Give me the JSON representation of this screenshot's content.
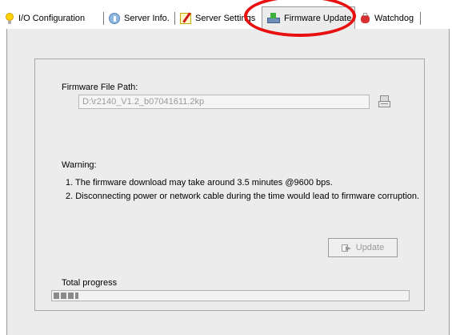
{
  "tabs": [
    {
      "label": "I/O Configuration",
      "icon": "bulb-icon"
    },
    {
      "label": "Server Info.",
      "icon": "info-icon"
    },
    {
      "label": "Server Settings",
      "icon": "settings-icon"
    },
    {
      "label": "Firmware Update",
      "icon": "firmware-icon",
      "active": true
    },
    {
      "label": "Watchdog",
      "icon": "watchdog-icon"
    }
  ],
  "firmware": {
    "path_label": "Firmware File Path:",
    "path_value": "D:\\r2140_V1.2_b07041611.2kp",
    "warning_label": "Warning:",
    "warning_1": "1. The firmware download may take around 3.5 minutes @9600 bps.",
    "warning_2": "2. Disconnecting power or network cable during the time would  lead to firmware corruption.",
    "update_label": "Update",
    "update_enabled": false,
    "progress_label": "Total progress",
    "progress_fraction": 0.07
  },
  "colors": {
    "highlight": "#e81010",
    "page_bg": "#ececec"
  }
}
